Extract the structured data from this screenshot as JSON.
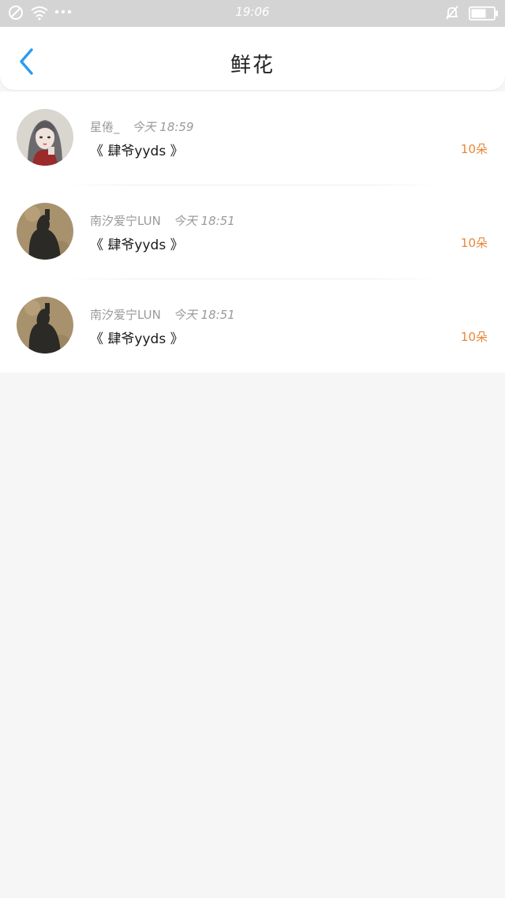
{
  "status_bar": {
    "time": "19:06",
    "icons": [
      "no-sim-icon",
      "wifi-icon",
      "more-dots-icon",
      "mute-bell-icon",
      "battery-icon"
    ]
  },
  "header": {
    "title": "鲜花",
    "back_icon": "chevron-left-icon",
    "accent_color": "#2b9bf0"
  },
  "items": [
    {
      "avatar": "avatar-girl-illustration",
      "name": "星倦_",
      "time": "今天 18:59",
      "book": "《 肆爷yyds 》",
      "count": "10朵"
    },
    {
      "avatar": "avatar-dark-silhouette",
      "name": "南汐爱宁LUN",
      "time": "今天 18:51",
      "book": "《 肆爷yyds 》",
      "count": "10朵"
    },
    {
      "avatar": "avatar-dark-silhouette",
      "name": "南汐爱宁LUN",
      "time": "今天 18:51",
      "book": "《 肆爷yyds 》",
      "count": "10朵"
    }
  ],
  "colors": {
    "count": "#e8873a",
    "meta_text": "#9a9a9a",
    "background": "#f6f6f6"
  }
}
